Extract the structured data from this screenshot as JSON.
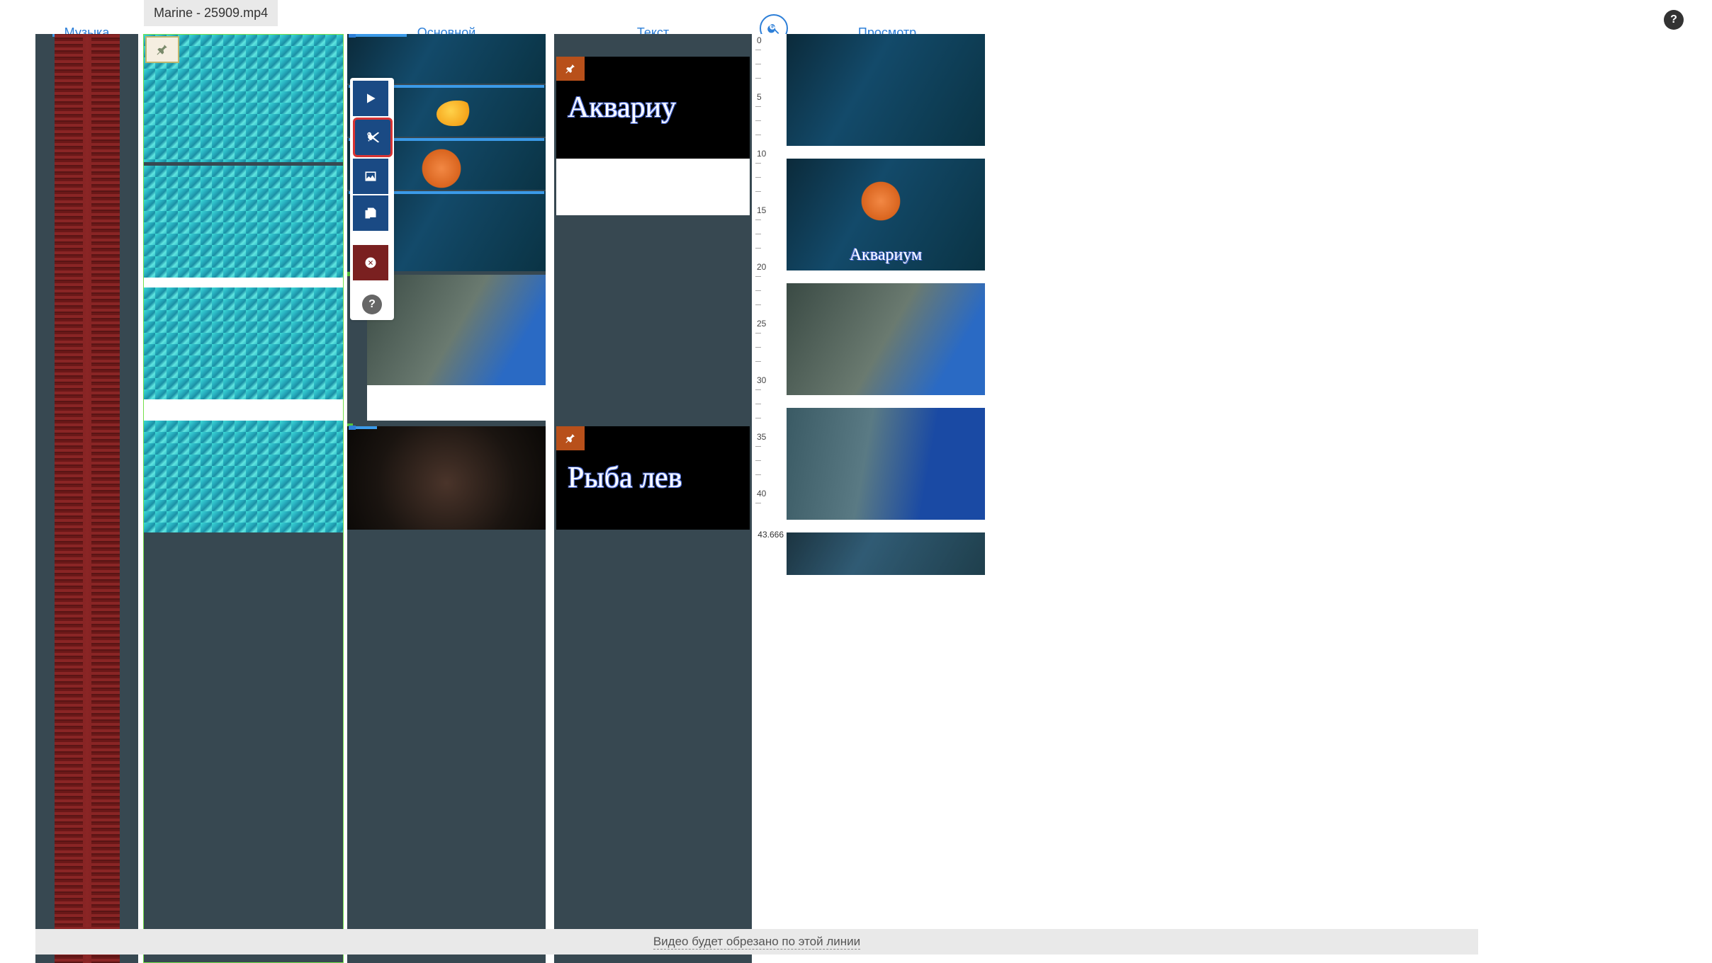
{
  "header": {
    "music_tab": "Музыка",
    "filename": "Marine - 25909.mp4",
    "main_tab": "Основной",
    "text_tab": "Текст",
    "preview_tab": "Просмотр"
  },
  "ruler": {
    "ticks": [
      "0",
      "5",
      "10",
      "15",
      "20",
      "25",
      "30",
      "35",
      "40"
    ],
    "end": "43.666"
  },
  "text_clips": [
    {
      "label": "Аквариу"
    },
    {
      "label": "Рыба лев"
    }
  ],
  "preview_overlay": "Аквариум",
  "footer": "Видео будет обрезано по этой линии",
  "icons": {
    "play": "play",
    "cut": "cut",
    "image": "image",
    "copy": "copy",
    "delete": "delete",
    "help": "?",
    "zoom": "zoom",
    "pin": "pin"
  }
}
